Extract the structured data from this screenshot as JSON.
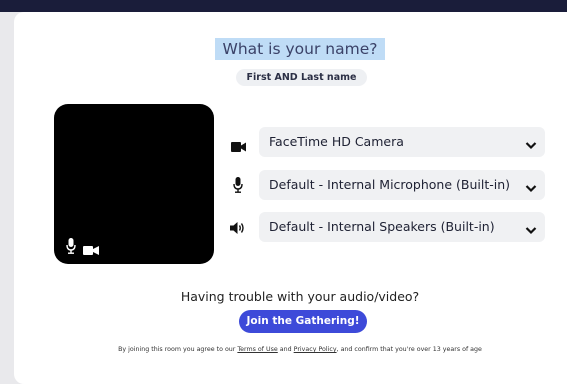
{
  "header": {
    "title": "What is your name?",
    "subtitle": "First AND Last name"
  },
  "devices": [
    {
      "icon": "camera-icon",
      "label": "FaceTime HD Camera"
    },
    {
      "icon": "microphone-icon",
      "label": "Default - Internal Microphone (Built-in)"
    },
    {
      "icon": "speaker-icon",
      "label": "Default - Internal Speakers (Built-in)"
    }
  ],
  "preview": {
    "icons": [
      "microphone-icon",
      "camera-icon"
    ]
  },
  "help": {
    "text": "Having trouble with your audio/video?"
  },
  "join_button": {
    "label": "Join the Gathering!"
  },
  "footer": {
    "prefix": "By joining this room you agree to our ",
    "terms": "Terms of Use",
    "and": " and ",
    "privacy": "Privacy Policy",
    "suffix": ", and confirm that you're over 13 years of age"
  },
  "colors": {
    "accent": "#3d4ad9",
    "topbar": "#1a1d3a",
    "title_highlight": "#bfdcf6"
  }
}
